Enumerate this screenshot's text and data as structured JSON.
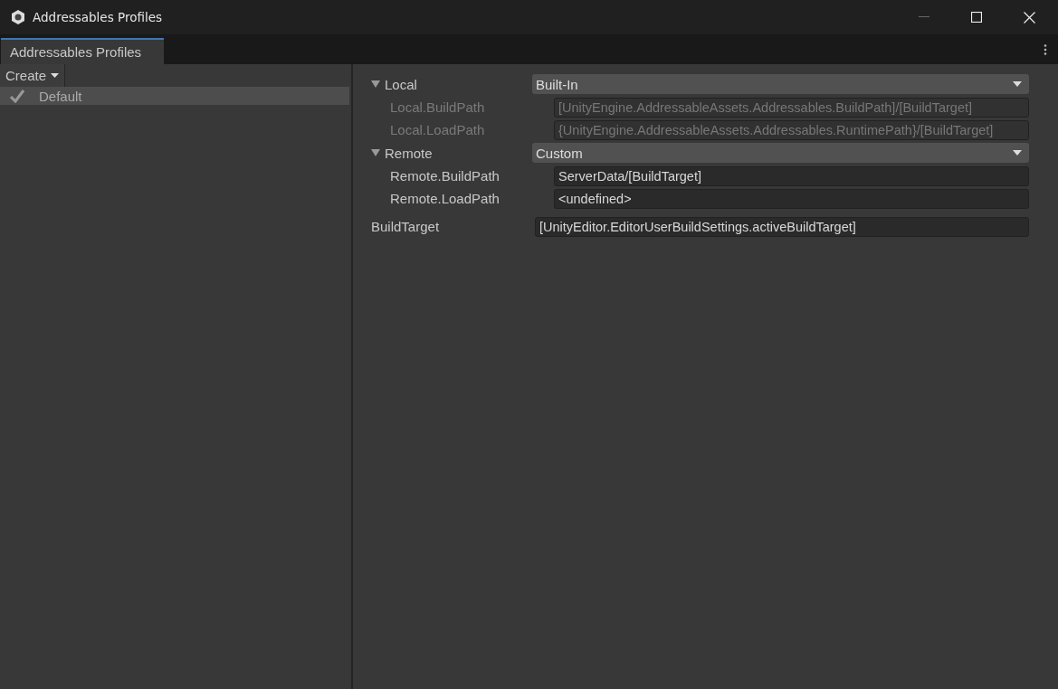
{
  "window": {
    "title": "Addressables Profiles"
  },
  "tabs": [
    {
      "label": "Addressables Profiles",
      "selected": true
    }
  ],
  "toolbar": {
    "create_menu": "Create"
  },
  "profiles": [
    {
      "name": "Default",
      "selected": true,
      "checked": true
    }
  ],
  "groups": [
    {
      "name": "Local",
      "expanded": true,
      "dropdown": "Built-In",
      "variables": [
        {
          "name": "Local.BuildPath",
          "value": "[UnityEngine.AddressableAssets.Addressables.BuildPath]/[BuildTarget]",
          "disabled": true
        },
        {
          "name": "Local.LoadPath",
          "value": "{UnityEngine.AddressableAssets.Addressables.RuntimePath}/[BuildTarget]",
          "disabled": true
        }
      ]
    },
    {
      "name": "Remote",
      "expanded": true,
      "dropdown": "Custom",
      "variables": [
        {
          "name": "Remote.BuildPath",
          "value": "ServerData/[BuildTarget]",
          "disabled": false
        },
        {
          "name": "Remote.LoadPath",
          "value": "<undefined>",
          "disabled": false
        }
      ]
    }
  ],
  "variables": [
    {
      "name": "BuildTarget",
      "value": "[UnityEditor.EditorUserBuildSettings.activeBuildTarget]",
      "disabled": false
    }
  ]
}
